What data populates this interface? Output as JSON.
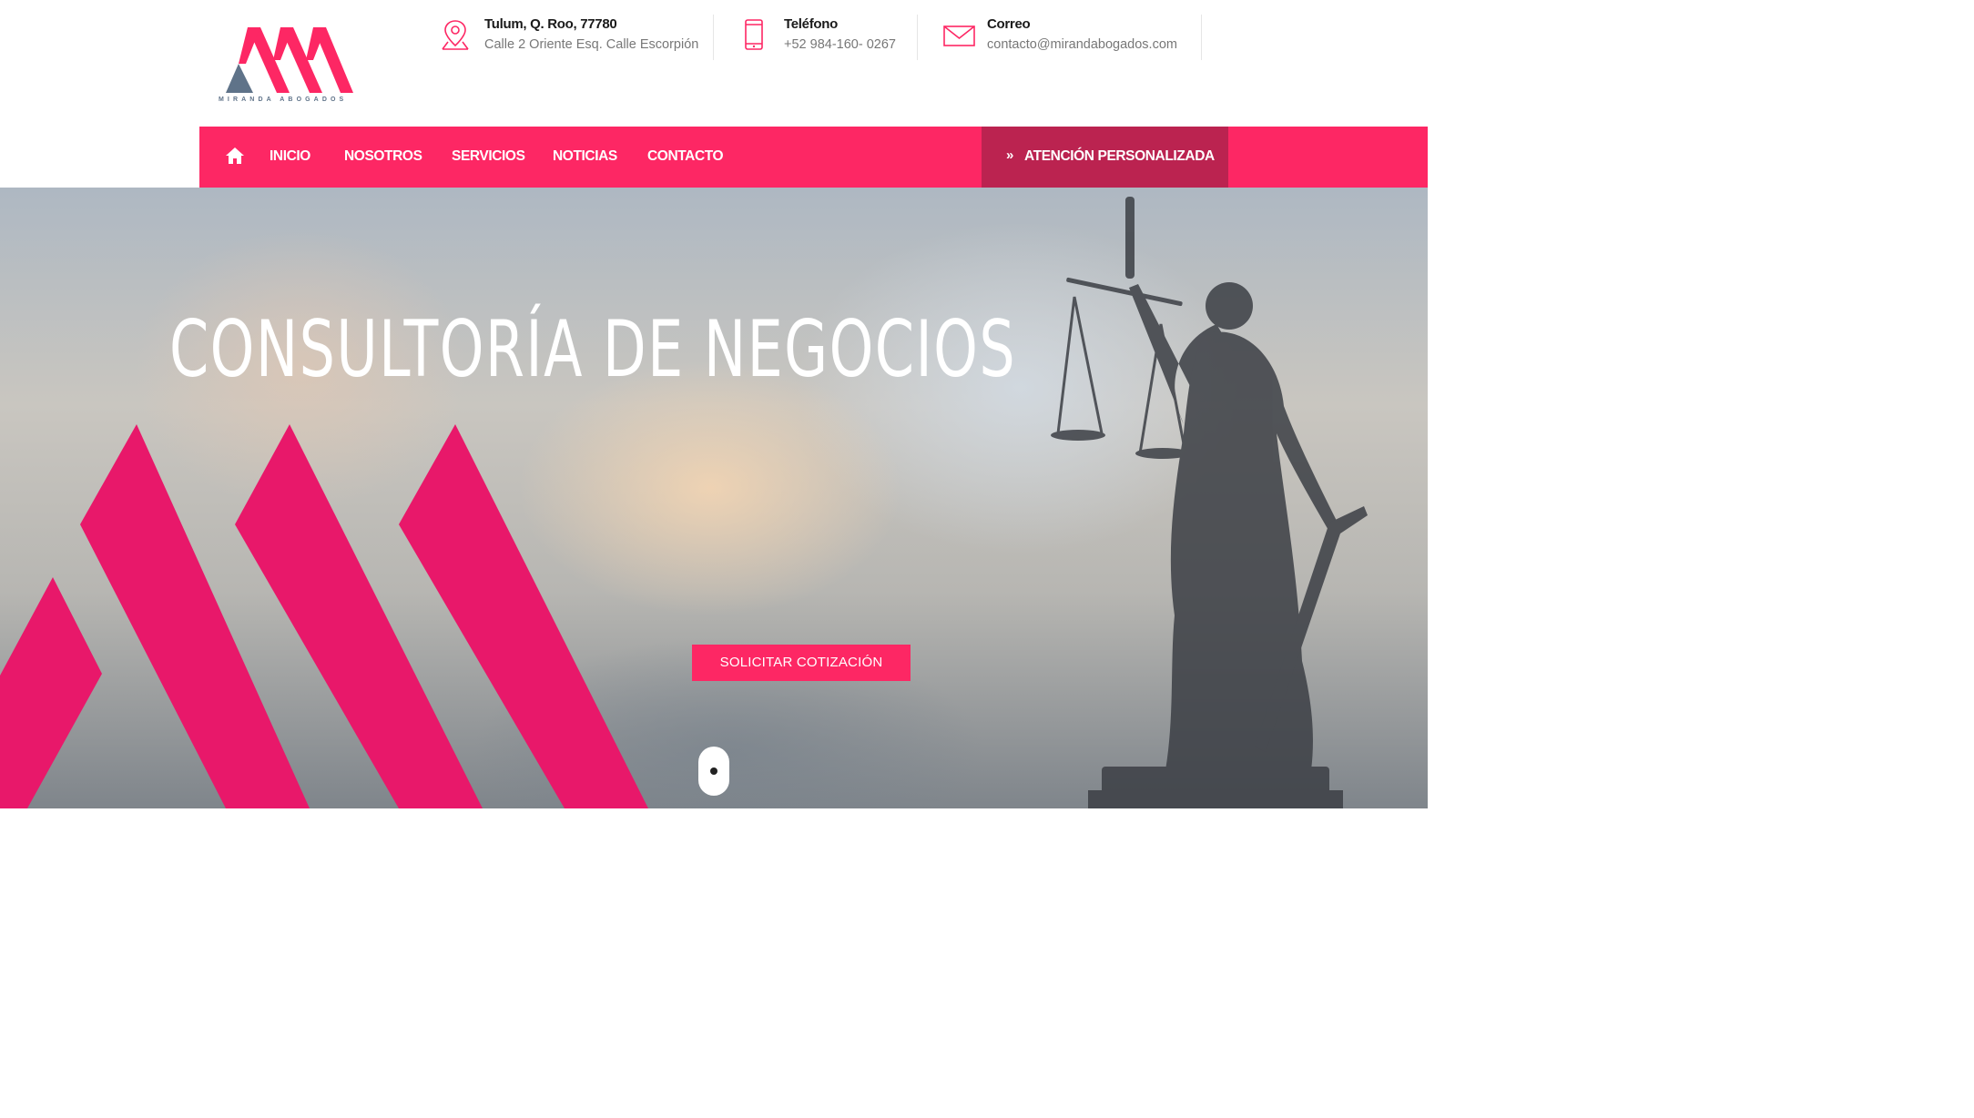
{
  "brand": {
    "name": "MIRANDA ABOGADOS",
    "colors": {
      "primary": "#fd2764",
      "primary_dark": "#bb2350",
      "slate": "#5f7389"
    }
  },
  "contact": {
    "address": {
      "icon": "location-pin-icon",
      "title": "Tulum, Q. Roo, 77780",
      "detail": "Calle 2 Oriente Esq. Calle Escorpión"
    },
    "phone": {
      "icon": "mobile-phone-icon",
      "title": "Teléfono",
      "detail": "+52 984-160- 0267"
    },
    "email": {
      "icon": "envelope-icon",
      "title": "Correo",
      "detail": "contacto@mirandabogados.com"
    }
  },
  "nav": {
    "home_icon": "home-icon",
    "items": [
      {
        "label": "INICIO"
      },
      {
        "label": "NOSOTROS"
      },
      {
        "label": "SERVICIOS"
      },
      {
        "label": "NOTICIAS"
      },
      {
        "label": "CONTACTO"
      }
    ],
    "cta": {
      "icon": "double-chevron-right-icon",
      "arrow": "»",
      "label": "ATENCIÓN PERSONALIZADA"
    }
  },
  "hero": {
    "title": "CONSULTORÍA DE NEGOCIOS",
    "button_label": "SOLICITAR COTIZACIÓN",
    "scroll_icon": "mouse-scroll-icon"
  }
}
